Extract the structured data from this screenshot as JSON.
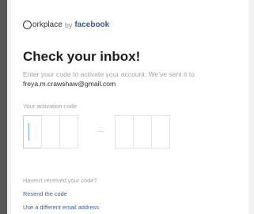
{
  "brand": {
    "word": "orkplace",
    "by": "by",
    "company": "facebook"
  },
  "heading": "Check your inbox!",
  "description": {
    "text": "Enter your code to activate your account. We've sent it to ",
    "email": "freya.m.crawshaw@gmail.com"
  },
  "activation": {
    "label": "Your activation code",
    "digits": [
      "",
      "",
      "",
      "",
      "",
      ""
    ],
    "active_index": 0
  },
  "help": {
    "question": "Haven't received your code?",
    "resend_link": "Resend the code",
    "alt_email_link": "Use a different email address"
  },
  "colors": {
    "link": "#365fb5",
    "brand_facebook": "#3b5998",
    "heading": "#1c1e21",
    "muted": "#a3a3a3"
  }
}
